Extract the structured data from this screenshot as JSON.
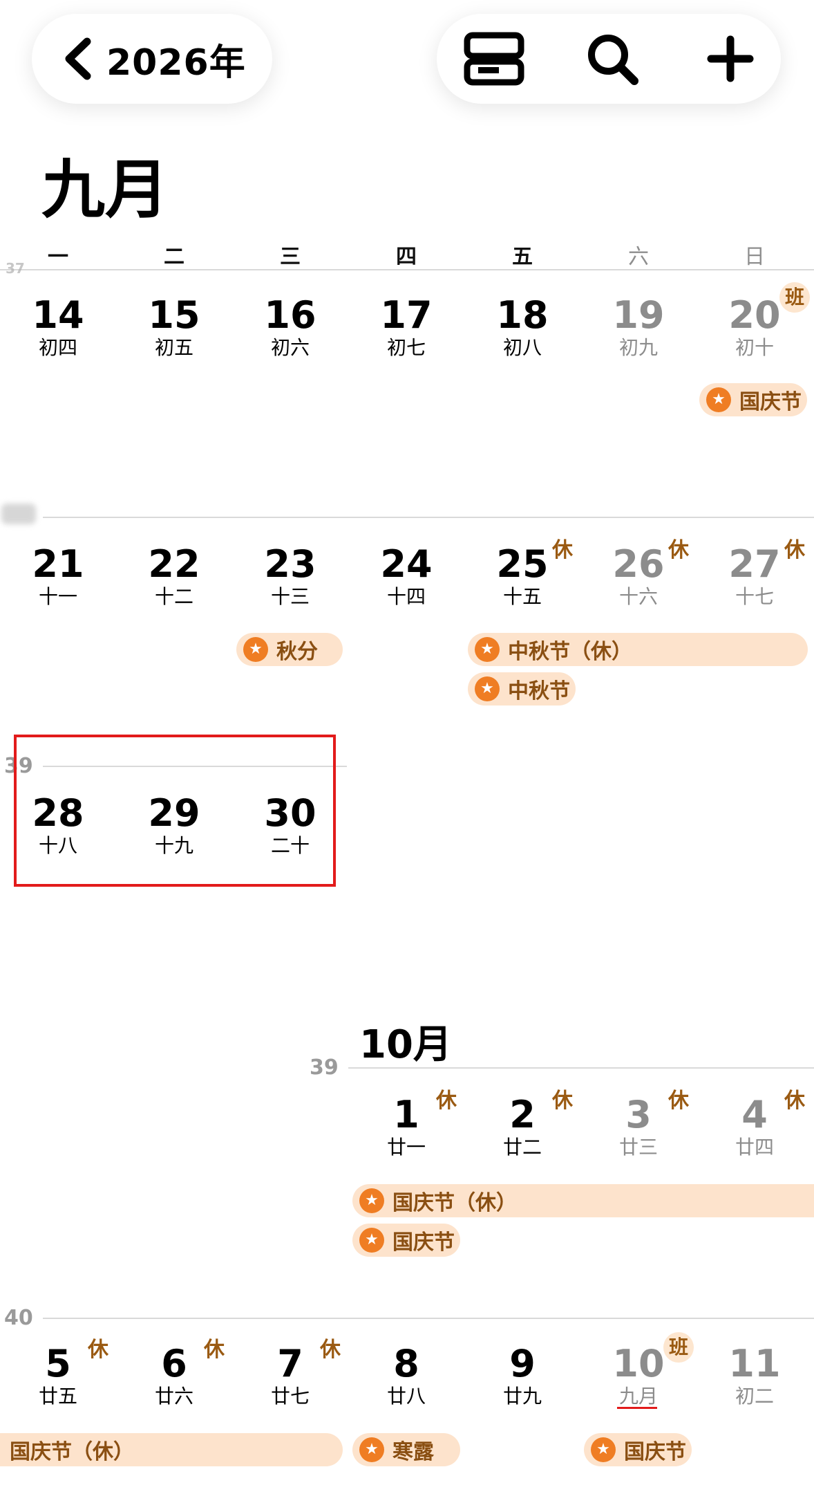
{
  "nav": {
    "year": "2026年"
  },
  "month_title": "九月",
  "month2_title": "10月",
  "weekdays": [
    "一",
    "二",
    "三",
    "四",
    "五",
    "六",
    "日"
  ],
  "week_numbers": {
    "w3": "39",
    "w4": "39",
    "w5": "40",
    "edge": "37"
  },
  "rows": {
    "r1": [
      {
        "num": "14",
        "lunar": "初四"
      },
      {
        "num": "15",
        "lunar": "初五"
      },
      {
        "num": "16",
        "lunar": "初六"
      },
      {
        "num": "17",
        "lunar": "初七"
      },
      {
        "num": "18",
        "lunar": "初八"
      },
      {
        "num": "19",
        "lunar": "初九"
      },
      {
        "num": "20",
        "lunar": "初十"
      }
    ],
    "r2": [
      {
        "num": "21",
        "lunar": "十一"
      },
      {
        "num": "22",
        "lunar": "十二"
      },
      {
        "num": "23",
        "lunar": "十三"
      },
      {
        "num": "24",
        "lunar": "十四"
      },
      {
        "num": "25",
        "lunar": "十五"
      },
      {
        "num": "26",
        "lunar": "十六"
      },
      {
        "num": "27",
        "lunar": "十七"
      }
    ],
    "r3": [
      {
        "num": "28",
        "lunar": "十八"
      },
      {
        "num": "29",
        "lunar": "十九"
      },
      {
        "num": "30",
        "lunar": "二十"
      }
    ],
    "r4": [
      {
        "num": "1",
        "lunar": "廿一"
      },
      {
        "num": "2",
        "lunar": "廿二"
      },
      {
        "num": "3",
        "lunar": "廿三"
      },
      {
        "num": "4",
        "lunar": "廿四"
      }
    ],
    "r5": [
      {
        "num": "5",
        "lunar": "廿五"
      },
      {
        "num": "6",
        "lunar": "廿六"
      },
      {
        "num": "7",
        "lunar": "廿七"
      },
      {
        "num": "8",
        "lunar": "廿八"
      },
      {
        "num": "9",
        "lunar": "廿九"
      },
      {
        "num": "10",
        "lunar": "九月"
      },
      {
        "num": "11",
        "lunar": "初二"
      }
    ]
  },
  "badges": {
    "work": "班",
    "rest": "休"
  },
  "events": {
    "national_day": "国庆节",
    "national_day_rest": "国庆节（休）",
    "autumn_equinox": "秋分",
    "mid_autumn": "中秋节",
    "mid_autumn_rest": "中秋节（休）",
    "cold_dew": "寒露"
  },
  "colors": {
    "event_bg": "#fde3cc",
    "event_star": "#ef7d23",
    "event_text": "#8a4f12",
    "highlight": "#e21b1b"
  }
}
